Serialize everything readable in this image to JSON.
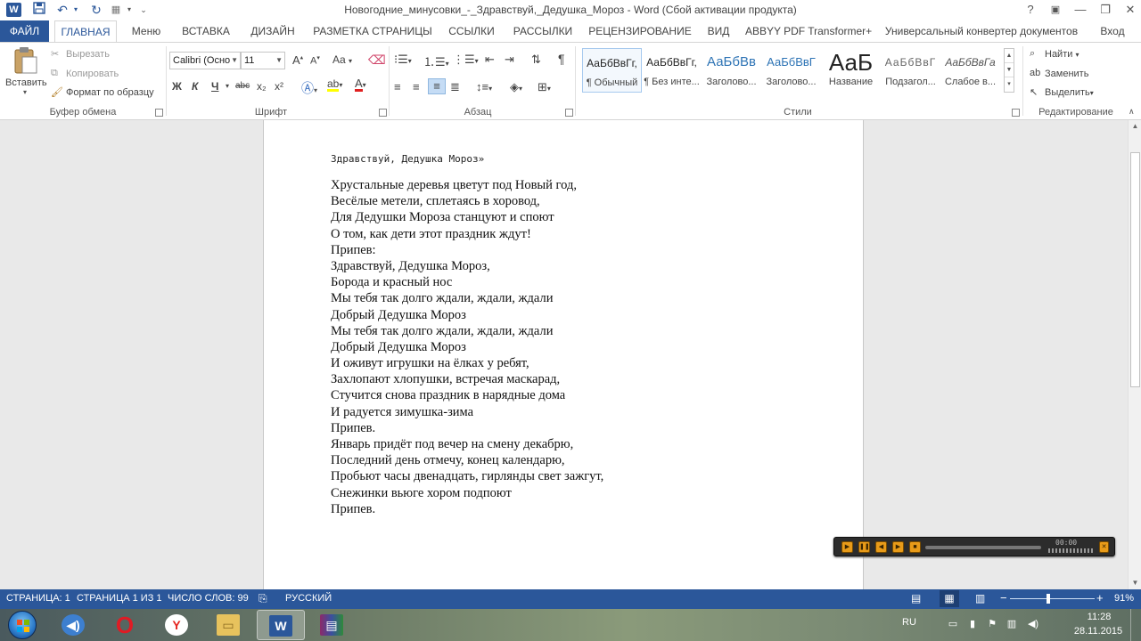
{
  "window": {
    "title": "Новогодние_минусовки_-_Здравствуй,_Дедушка_Мороз - Word (Сбой активации продукта)",
    "help": "?",
    "restore_icon": "ribbon-display-icon",
    "minimize": "—",
    "maximize": "❐",
    "close": "✕"
  },
  "qat": {
    "app_icon_letter": "W",
    "save": "save-icon",
    "undo": "undo-icon",
    "redo": "redo-icon"
  },
  "tabs": {
    "file": "ФАЙЛ",
    "items": [
      "ГЛАВНАЯ",
      "Меню",
      "ВСТАВКА",
      "ДИЗАЙН",
      "РАЗМЕТКА СТРАНИЦЫ",
      "ССЫЛКИ",
      "РАССЫЛКИ",
      "РЕЦЕНЗИРОВАНИЕ",
      "ВИД",
      "ABBYY PDF Transformer+",
      "Универсальный конвертер документов"
    ],
    "signin": "Вход"
  },
  "clipboard": {
    "paste": "Вставить",
    "cut": "Вырезать",
    "copy": "Копировать",
    "format_painter": "Формат по образцу",
    "group_label": "Буфер обмена"
  },
  "font": {
    "name": "Calibri (Осно",
    "size": "11",
    "grow": "A",
    "shrink": "A",
    "case": "Aa",
    "bold": "Ж",
    "italic": "К",
    "underline": "Ч",
    "strike": "abc",
    "subscript": "x₂",
    "superscript": "x²",
    "group_label": "Шрифт"
  },
  "paragraph": {
    "group_label": "Абзац",
    "pilcrow": "¶"
  },
  "styles": {
    "group_label": "Стили",
    "items": [
      {
        "sample": "АаБбВвГг,",
        "name": "¶ Обычный"
      },
      {
        "sample": "АаБбВвГг,",
        "name": "¶ Без инте..."
      },
      {
        "sample": "АаБбВв",
        "name": "Заголово..."
      },
      {
        "sample": "АаБбВвГ",
        "name": "Заголово..."
      },
      {
        "sample": "АаБ",
        "name": "Название"
      },
      {
        "sample": "АаБбВвГ",
        "name": "Подзагол..."
      },
      {
        "sample": "АаБбВвГа",
        "name": "Слабое в..."
      }
    ]
  },
  "editing": {
    "find": "Найти",
    "replace": "Заменить",
    "select": "Выделить",
    "group_label": "Редактирование"
  },
  "document": {
    "heading": "Здравствуй, Дедушка Мороз»",
    "lines": [
      "Хрустальные деревья цветут под Новый год,",
      "Весёлые метели, сплетаясь в хоровод,",
      "Для Дедушки Мороза станцуют и споют",
      "О том, как дети этот праздник ждут!",
      "Припев:",
      "Здравствуй, Дедушка Мороз,",
      "Борода и красный нос",
      "Мы тебя так долго ждали, ждали, ждали",
      "Добрый Дедушка Мороз",
      "Мы тебя так долго ждали, ждали, ждали",
      "Добрый Дедушка Мороз",
      "И оживут игрушки на ёлках у ребят,",
      "Захлопают хлопушки, встречая маскарад,",
      "Стучится снова праздник в нарядные дома",
      "И радуется зимушка-зима",
      "Припев.",
      "Январь придёт под вечер на смену декабрю,",
      "Последний день отмечу, конец календарю,",
      "Пробьют часы двенадцать, гирлянды свет зажгут,",
      "Снежинки вьюге хором подпоют",
      "Припев."
    ]
  },
  "player": {
    "time": "00:00"
  },
  "status": {
    "page": "СТРАНИЦА: 1",
    "pages": "СТРАНИЦА 1 ИЗ 1",
    "words": "ЧИСЛО СЛОВ: 99",
    "language": "РУССКИЙ",
    "zoom_minus": "−",
    "zoom_plus": "+",
    "zoom": "91%"
  },
  "taskbar": {
    "lang": "RU",
    "time": "11:28",
    "date": "28.11.2015",
    "apps": [
      "speaker-icon",
      "opera-icon",
      "yandex-browser-icon",
      "file-explorer-icon",
      "word-icon",
      "winrar-icon"
    ]
  },
  "colors": {
    "accent": "#2b579a"
  }
}
